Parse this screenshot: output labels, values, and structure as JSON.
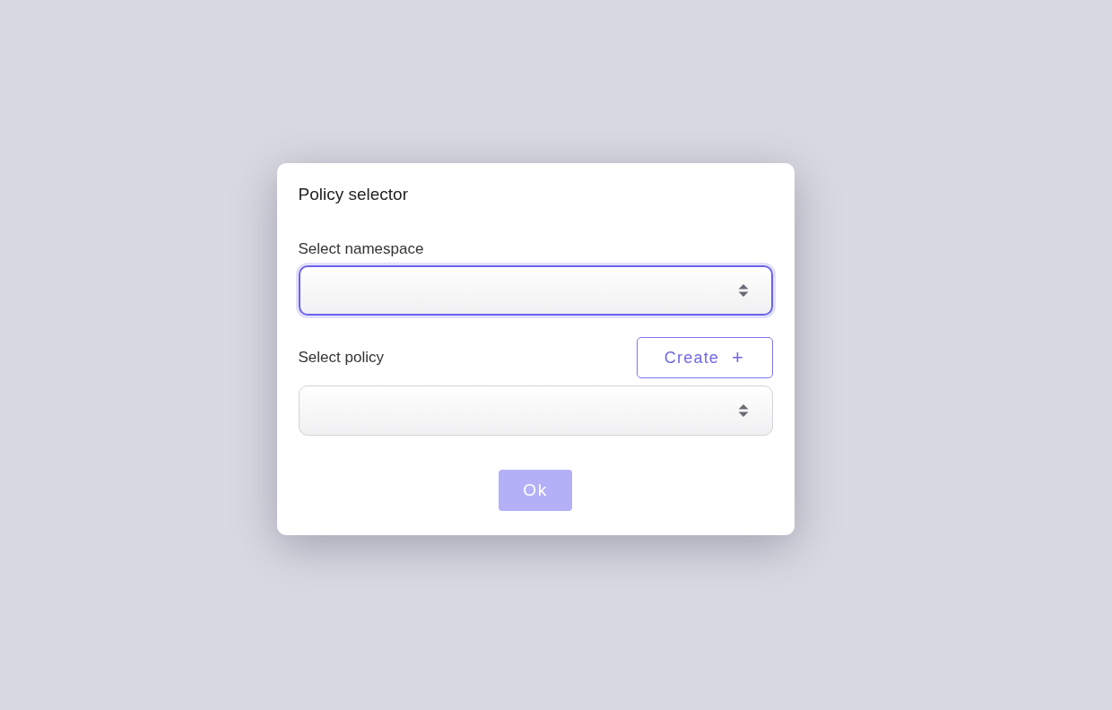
{
  "dialog": {
    "title": "Policy selector",
    "fields": [
      {
        "label": "Select namespace",
        "focused": true
      },
      {
        "label": "Select policy",
        "focused": false,
        "action": {
          "label": "Create",
          "icon": "+"
        }
      }
    ],
    "ok_button": {
      "label": "Ok",
      "disabled": true
    }
  }
}
